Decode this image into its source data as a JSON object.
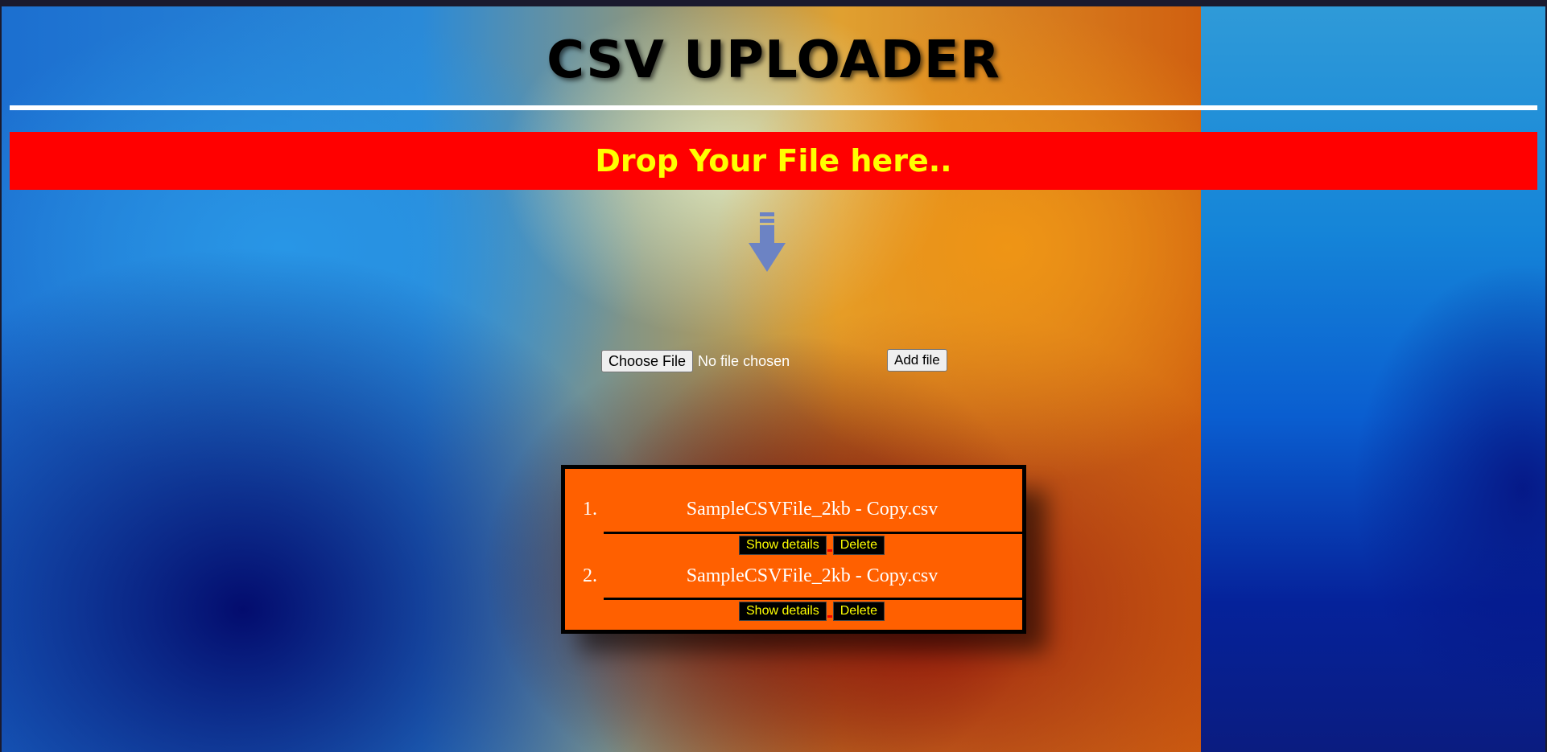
{
  "header": {
    "title": "CSV UPLOADER"
  },
  "dropzone": {
    "label": "Drop Your File here..",
    "icon": "arrow-down-icon"
  },
  "upload": {
    "choose_label": "Choose File",
    "status_text": "No file chosen",
    "add_label": "Add file"
  },
  "files": [
    {
      "number": "1.",
      "name": "SampleCSVFile_2kb - Copy.csv",
      "details_label": "Show details",
      "delete_label": "Delete"
    },
    {
      "number": "2.",
      "name": "SampleCSVFile_2kb - Copy.csv",
      "details_label": "Show details",
      "delete_label": "Delete"
    }
  ],
  "colors": {
    "banner": "#ff0000",
    "banner_text": "#ffff00",
    "list_bg": "#ff6000",
    "button_text": "#ffff00"
  }
}
